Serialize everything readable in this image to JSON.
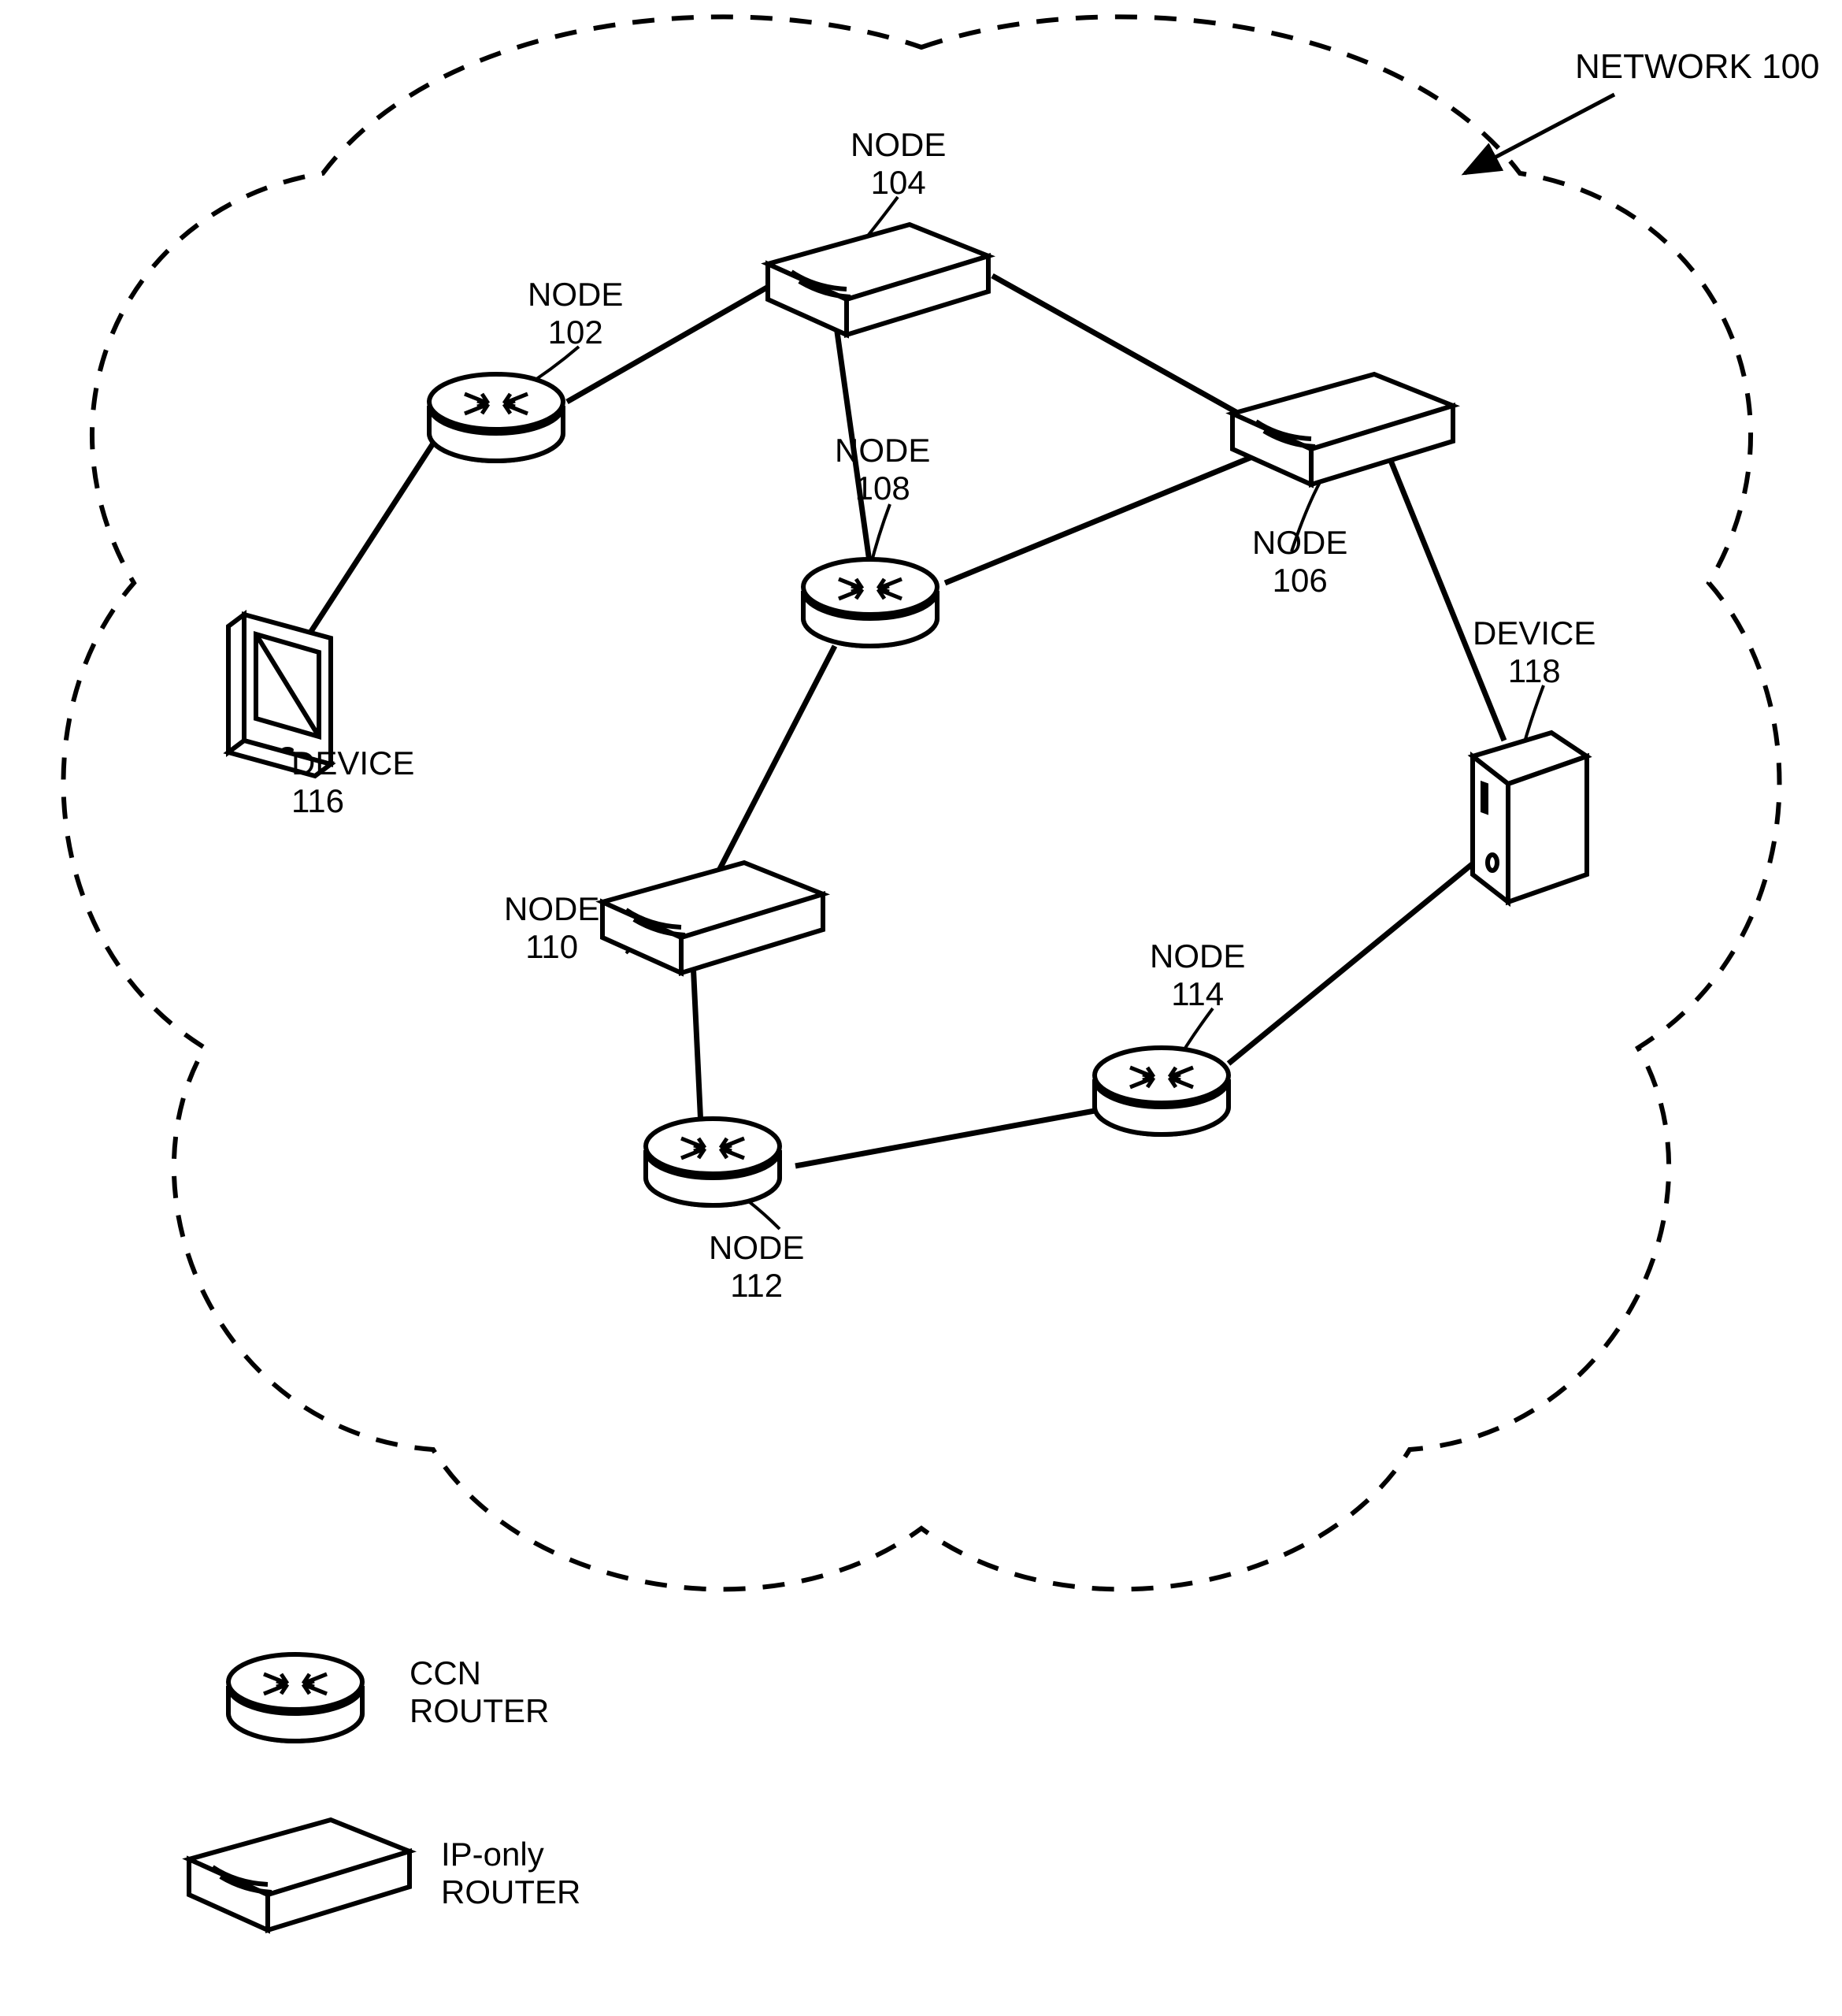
{
  "diagram": {
    "type": "network-topology",
    "network_label": "NETWORK 100",
    "nodes": {
      "n102": {
        "label": "NODE",
        "id": "102",
        "kind": "ccn-router"
      },
      "n104": {
        "label": "NODE",
        "id": "104",
        "kind": "ip-router"
      },
      "n106": {
        "label": "NODE",
        "id": "106",
        "kind": "ip-router"
      },
      "n108": {
        "label": "NODE",
        "id": "108",
        "kind": "ccn-router"
      },
      "n110": {
        "label": "NODE",
        "id": "110",
        "kind": "ip-router"
      },
      "n112": {
        "label": "NODE",
        "id": "112",
        "kind": "ccn-router"
      },
      "n114": {
        "label": "NODE",
        "id": "114",
        "kind": "ccn-router"
      },
      "d116": {
        "label": "DEVICE",
        "id": "116",
        "kind": "phone"
      },
      "d118": {
        "label": "DEVICE",
        "id": "118",
        "kind": "server"
      }
    },
    "edges": [
      [
        "d116",
        "n102"
      ],
      [
        "n102",
        "n104"
      ],
      [
        "n104",
        "n106"
      ],
      [
        "n104",
        "n108"
      ],
      [
        "n108",
        "n106"
      ],
      [
        "n108",
        "n110"
      ],
      [
        "n110",
        "n112"
      ],
      [
        "n112",
        "n114"
      ],
      [
        "n114",
        "d118"
      ],
      [
        "n106",
        "d118"
      ]
    ],
    "legend": {
      "ccn": "CCN\nROUTER",
      "ip": "IP-only\nROUTER"
    }
  }
}
